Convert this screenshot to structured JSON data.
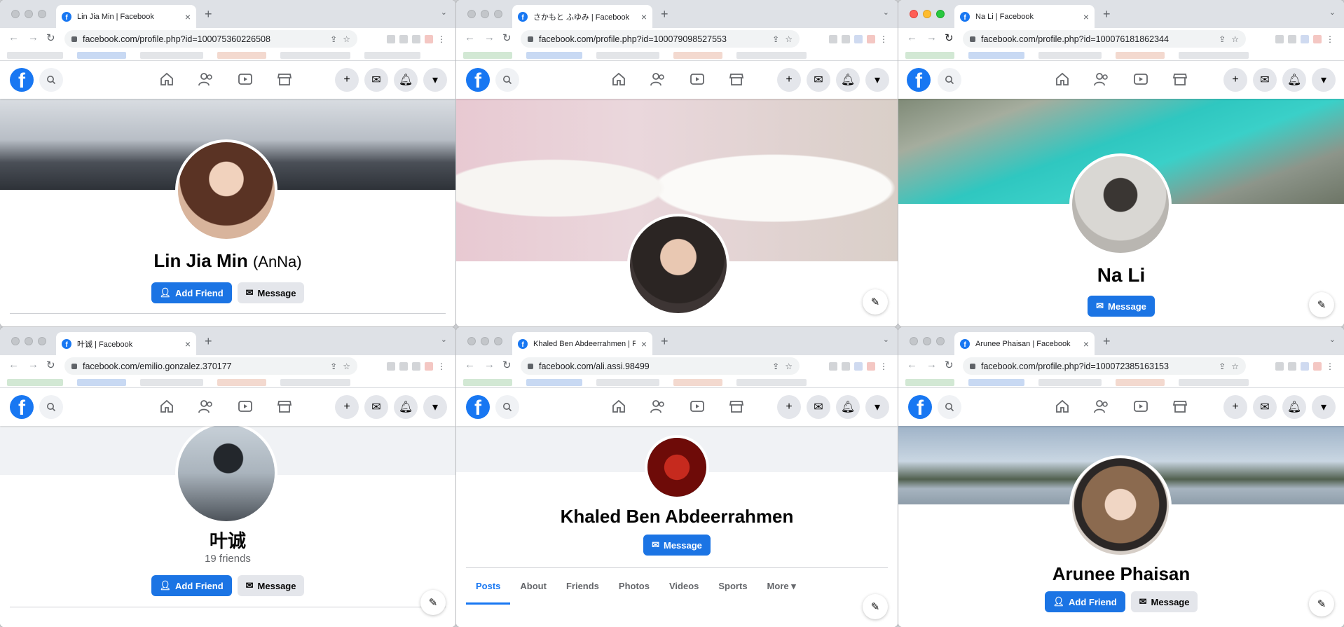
{
  "windows": [
    {
      "tab_title": "Lin Jia Min | Facebook",
      "url": "facebook.com/profile.php?id=100075360226508",
      "name": "Lin Jia Min",
      "name_alt": "(AnNa)",
      "buttons": {
        "add_friend": "Add Friend",
        "message": "Message"
      }
    },
    {
      "tab_title": "さかもと ふゆみ | Facebook",
      "url": "facebook.com/profile.php?id=100079098527553"
    },
    {
      "tab_title": "Na Li | Facebook",
      "url": "facebook.com/profile.php?id=100076181862344",
      "name": "Na Li",
      "buttons": {
        "message": "Message"
      }
    },
    {
      "tab_title": "叶诚 | Facebook",
      "url": "facebook.com/emilio.gonzalez.370177",
      "name": "叶诚",
      "friends": "19 friends",
      "buttons": {
        "add_friend": "Add Friend",
        "message": "Message"
      }
    },
    {
      "tab_title": "Khaled Ben Abdeerrahmen | Fa",
      "url": "facebook.com/ali.assi.98499",
      "name": "Khaled Ben Abdeerrahmen",
      "buttons": {
        "message": "Message"
      },
      "profile_tabs": [
        "Posts",
        "About",
        "Friends",
        "Photos",
        "Videos",
        "Sports",
        "More ▾"
      ]
    },
    {
      "tab_title": "Arunee Phaisan | Facebook",
      "url": "facebook.com/profile.php?id=100072385163153",
      "name": "Arunee Phaisan",
      "buttons": {
        "add_friend": "Add Friend",
        "message": "Message"
      }
    }
  ],
  "colors": {
    "facebook_blue": "#1877f2",
    "button_blue": "#1b74e4"
  }
}
